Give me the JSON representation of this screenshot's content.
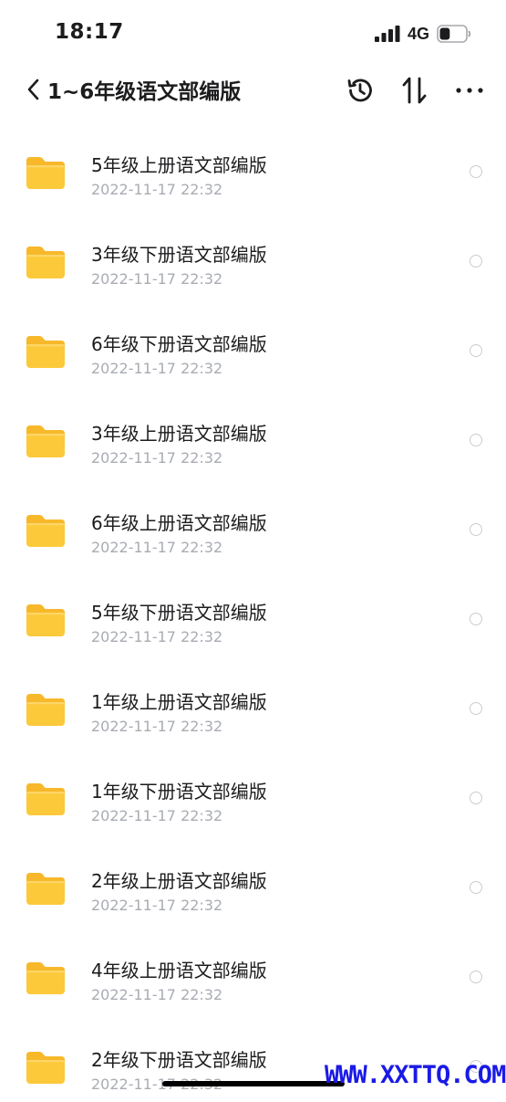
{
  "status_bar": {
    "time": "18:17",
    "network": "4G",
    "signal_icon": "cellular-signal-icon",
    "battery_icon": "battery-icon",
    "battery_level_percent": 40
  },
  "nav": {
    "back_icon": "chevron-left-icon",
    "title": "1~6年级语文部编版",
    "actions": [
      "history-icon",
      "sort-icon",
      "more-icon"
    ]
  },
  "items": [
    {
      "name": "5年级上册语文部编版",
      "date": "2022-11-17 22:32"
    },
    {
      "name": "3年级下册语文部编版",
      "date": "2022-11-17 22:32"
    },
    {
      "name": "6年级下册语文部编版",
      "date": "2022-11-17 22:32"
    },
    {
      "name": "3年级上册语文部编版",
      "date": "2022-11-17 22:32"
    },
    {
      "name": "6年级上册语文部编版",
      "date": "2022-11-17 22:32"
    },
    {
      "name": "5年级下册语文部编版",
      "date": "2022-11-17 22:32"
    },
    {
      "name": "1年级上册语文部编版",
      "date": "2022-11-17 22:32"
    },
    {
      "name": "1年级下册语文部编版",
      "date": "2022-11-17 22:32"
    },
    {
      "name": "2年级上册语文部编版",
      "date": "2022-11-17 22:32"
    },
    {
      "name": "4年级上册语文部编版",
      "date": "2022-11-17 22:32"
    },
    {
      "name": "2年级下册语文部编版",
      "date": "2022-11-17 22:32"
    }
  ],
  "watermark": "WWW.XXTTQ.COM",
  "colors": {
    "folder": "#fcc93a",
    "folder_back": "#f7b82a",
    "date_text": "#a9acb3",
    "watermark": "#1a1ae6"
  }
}
